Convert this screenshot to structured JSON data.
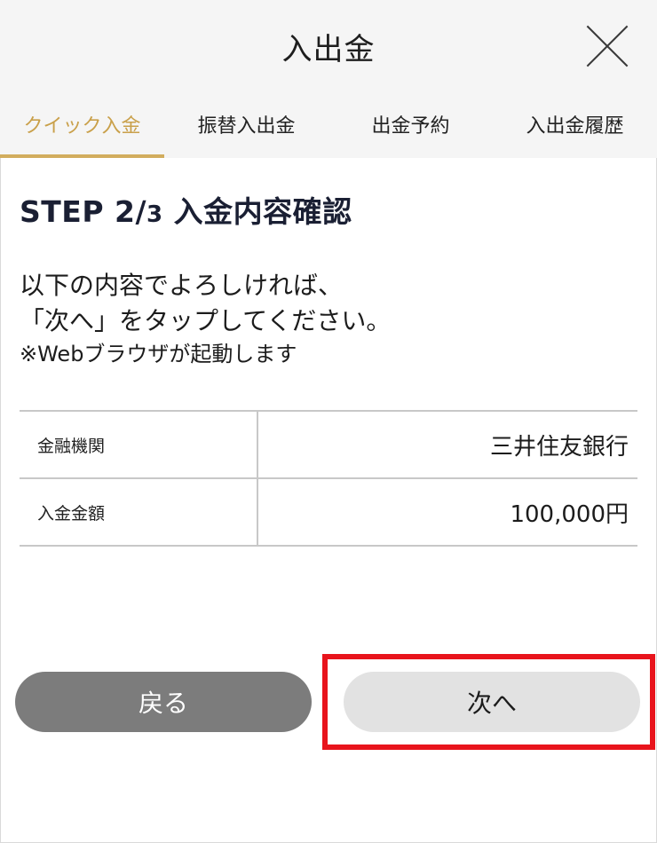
{
  "header": {
    "title": "入出金"
  },
  "tabs": [
    {
      "label": "クイック入金",
      "active": true
    },
    {
      "label": "振替入出金",
      "active": false
    },
    {
      "label": "出金予約",
      "active": false
    },
    {
      "label": "入出金履歴",
      "active": false
    }
  ],
  "step": {
    "title_prefix": "STEP 2/",
    "title_total": "3",
    "title_suffix": " 入金内容確認"
  },
  "description": {
    "line1": "以下の内容でよろしければ、",
    "line2": "「次へ」をタップしてください。",
    "note": "※Webブラウザが起動します"
  },
  "table": {
    "rows": [
      {
        "label": "金融機関",
        "value": "三井住友銀行"
      },
      {
        "label": "入金金額",
        "value": "100,000円"
      }
    ]
  },
  "buttons": {
    "back_label": "戻る",
    "next_label": "次へ"
  },
  "colors": {
    "accent_gold": "#d2ad5e",
    "highlight_red": "#e8141c",
    "back_button": "#7c7c7c",
    "next_button": "#e2e2e2"
  }
}
